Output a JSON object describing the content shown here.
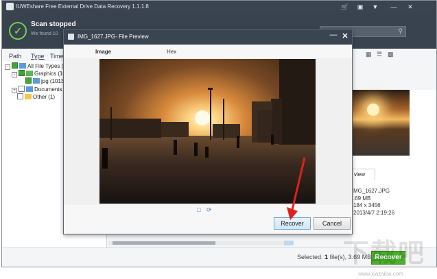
{
  "window": {
    "title": "IUWEshare Free External Drive Data Recovery 1.1.1.8",
    "buttons": [
      "cart-icon",
      "feedback-icon",
      "menu-icon",
      "minimize",
      "close"
    ]
  },
  "header": {
    "status_title": "Scan stopped",
    "status_sub": "We found 10",
    "search_placeholder": "Search"
  },
  "columns": {
    "path": "Path",
    "type": "Type",
    "time": "Time"
  },
  "tree": [
    {
      "label": "All File Types (1"
    },
    {
      "label": "Graphics (10"
    },
    {
      "label": "jpg (1013"
    },
    {
      "label": "Documents"
    },
    {
      "label": "Other (1)"
    }
  ],
  "right_panel": {
    "preview_tab": "view",
    "file_name": "MG_1627.JPG",
    "file_size": ".69 MB",
    "dimensions": "184 x 3456",
    "date": "2013/4/7 2:19:26"
  },
  "dialog": {
    "title": "IMG_1627.JPG- File Preview",
    "tab_image": "Image",
    "tab_hex": "Hex",
    "recover_label": "Recover",
    "cancel_label": "Cancel"
  },
  "bottom": {
    "selected_prefix": "Selected:",
    "selected_count": "1",
    "selected_suffix": "file(s), 3.69 MB",
    "recover_label": "Recover"
  },
  "watermark": {
    "text": "下载吧",
    "url": "www.xiazaiba.com"
  },
  "colors": {
    "titlebar": "#3a4450",
    "header": "#39434f",
    "accent_green": "#4caf2e",
    "arrow_red": "#e0201c"
  }
}
